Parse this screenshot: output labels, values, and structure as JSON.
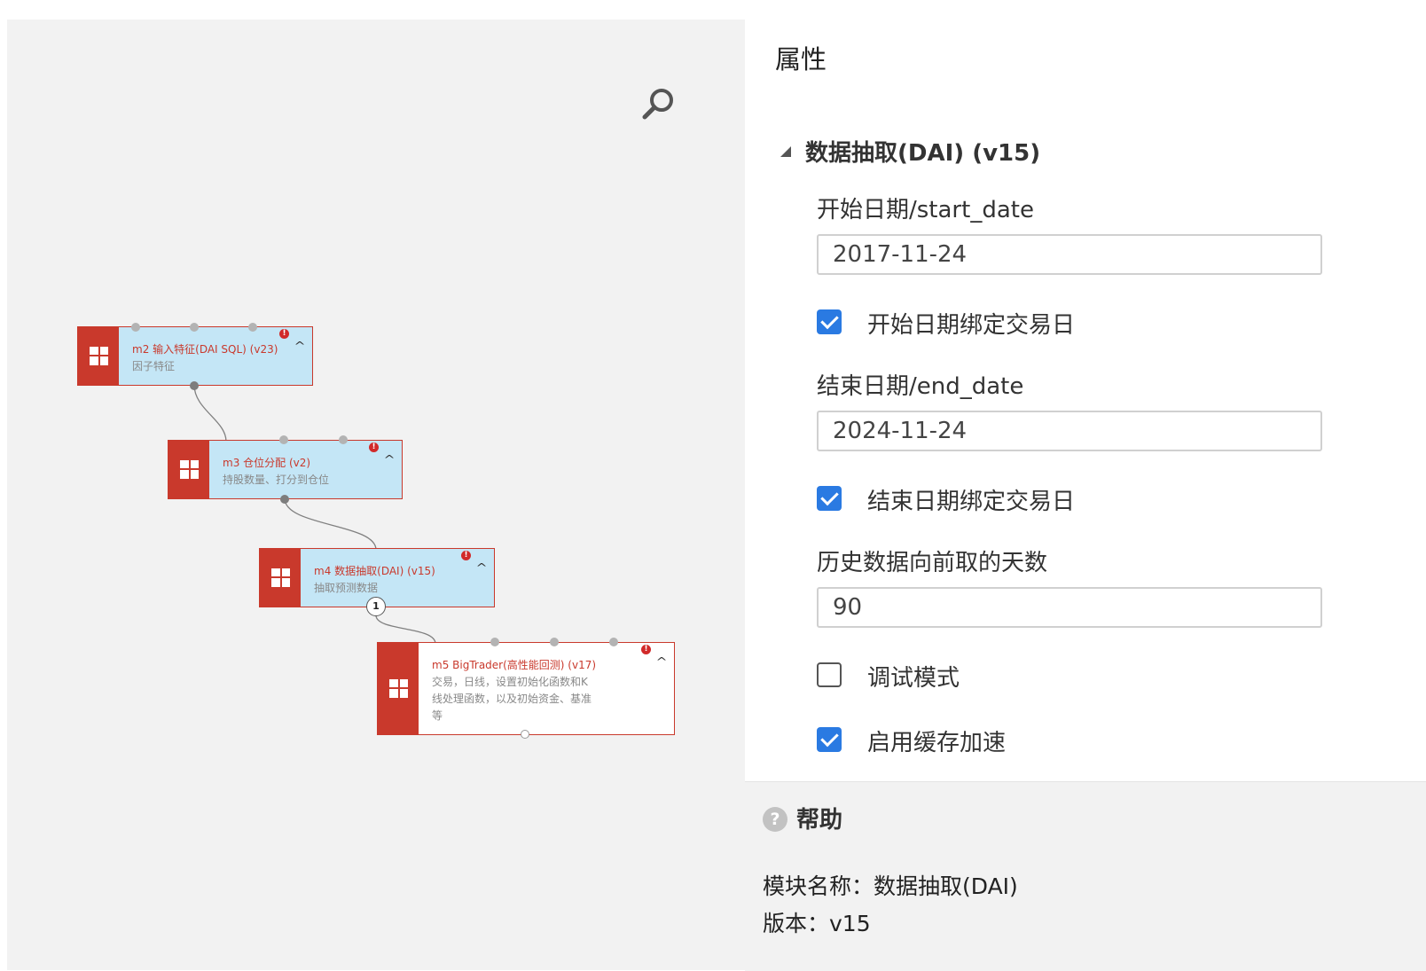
{
  "canvas": {
    "nodes": [
      {
        "id": "m2",
        "title": "m2 输入特征(DAI SQL) (v23)",
        "desc": "因子特征",
        "error": "!"
      },
      {
        "id": "m3",
        "title": "m3 仓位分配 (v2)",
        "desc": "持股数量、打分到仓位",
        "error": "!"
      },
      {
        "id": "m4",
        "title": "m4 数据抽取(DAI) (v15)",
        "desc": "抽取预测数据",
        "error": "!",
        "badge": "1"
      },
      {
        "id": "m5",
        "title": "m5 BigTrader(高性能回测) (v17)",
        "desc": "交易，日线，设置初始化函数和K线处理函数，以及初始资金、基准等",
        "error": "!"
      }
    ],
    "chevron": "^"
  },
  "panel": {
    "title": "属性",
    "section": "数据抽取(DAI) (v15)",
    "start_date_label": "开始日期/start_date",
    "start_date_value": "2017-11-24",
    "start_bind_label": "开始日期绑定交易日",
    "end_date_label": "结束日期/end_date",
    "end_date_value": "2024-11-24",
    "end_bind_label": "结束日期绑定交易日",
    "history_days_label": "历史数据向前取的天数",
    "history_days_value": "90",
    "debug_label": "调试模式",
    "cache_label": "启用缓存加速",
    "checks": {
      "start_bind": true,
      "end_bind": true,
      "debug": false,
      "cache": true
    },
    "accent_color": "#2a7ae2"
  },
  "help": {
    "icon": "?",
    "title": "帮助",
    "module_name": "模块名称：数据抽取(DAI)",
    "version": "版本：v15"
  },
  "colors": {
    "node_red": "#c9392c",
    "node_blue": "#c4e6f6",
    "canvas_bg": "#f2f2f2"
  }
}
